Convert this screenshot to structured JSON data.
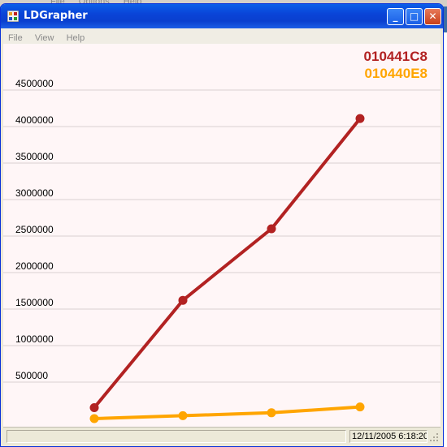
{
  "background_menu": [
    "File",
    "Options",
    "Help"
  ],
  "window": {
    "title": "LDGrapher",
    "controls": {
      "minimize": "_",
      "maximize": "□",
      "close": "✕"
    }
  },
  "menu": [
    "File",
    "View",
    "Help"
  ],
  "legend": [
    {
      "label": "010441C8",
      "color": "#b22222"
    },
    {
      "label": "010440E8",
      "color": "#ffa500"
    }
  ],
  "status": {
    "timestamp": "12/11/2005 6:18:20"
  },
  "chart_data": {
    "type": "line",
    "x": [
      1,
      2,
      3,
      4
    ],
    "ylim": [
      0,
      5000000
    ],
    "yticks": [
      "500000",
      "1000000",
      "1500000",
      "2000000",
      "2500000",
      "3000000",
      "3500000",
      "4000000",
      "4500000"
    ],
    "grid": true,
    "legend_position": "top-right",
    "series": [
      {
        "name": "010441C8",
        "color": "#b22222",
        "values": [
          150000,
          1620000,
          2600000,
          4110000
        ]
      },
      {
        "name": "010440E8",
        "color": "#ffa500",
        "values": [
          0,
          40000,
          80000,
          160000
        ]
      }
    ]
  }
}
